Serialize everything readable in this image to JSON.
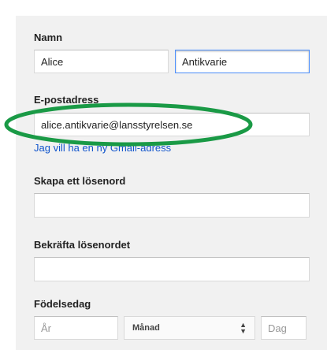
{
  "form": {
    "name_label": "Namn",
    "first_name": "Alice",
    "last_name": "Antikvarie",
    "email_label": "E-postadress",
    "email_value": "alice.antikvarie@lansstyrelsen.se",
    "new_gmail_link": "Jag vill ha en ny Gmail-adress",
    "password_label": "Skapa ett lösenord",
    "confirm_label": "Bekräfta lösenordet",
    "birthday_label": "Födelsedag",
    "year_placeholder": "År",
    "month_label": "Månad",
    "day_placeholder": "Dag"
  },
  "annotation": {
    "color": "#1a9a46",
    "shape": "ellipse"
  }
}
